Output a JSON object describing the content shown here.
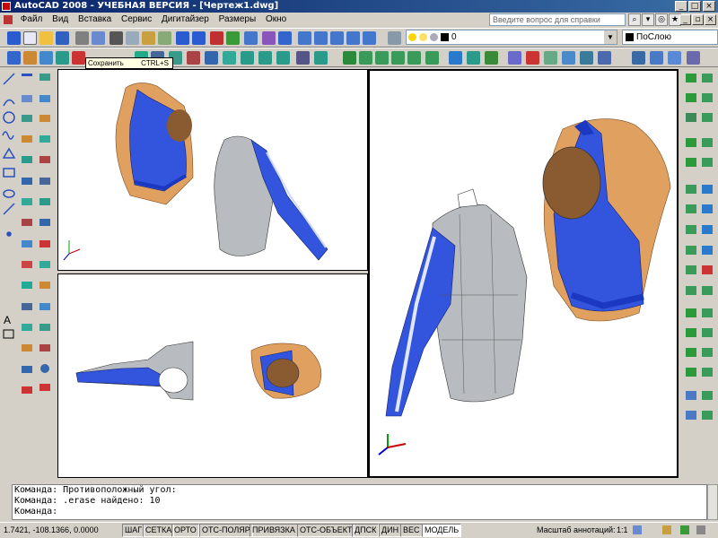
{
  "title": "AutoCAD 2008 - УЧЕБНАЯ ВЕРСИЯ - [Чертеж1.dwg]",
  "menu": [
    "Файл",
    "Вид",
    "Вставка",
    "Сервис",
    "Дигитайзер",
    "Размеры",
    "Окно"
  ],
  "help_placeholder": "Введите вопрос для справки",
  "layer_value": "0",
  "color_value": "ПоСлою",
  "tooltip": {
    "label": "Сохранить",
    "shortcut": "CTRL+S"
  },
  "command_lines": [
    "Команда: Противоположный угол:",
    "Команда:  .erase найдено: 10",
    "Команда:"
  ],
  "status": {
    "coords": "1.7421, -108.1366, 0.0000",
    "buttons": [
      "ШАГ",
      "СЕТКА",
      "ОРТО",
      "ОТС-ПОЛЯР",
      "ПРИВЯЗКА",
      "ОТС-ОБЪЕКТ",
      "ДПСК",
      "ДИН",
      "ВЕС",
      "МОДЕЛЬ"
    ],
    "scale_label": "Масштаб аннотаций:",
    "scale_value": "1:1"
  },
  "colors": {
    "title_start": "#0a246a",
    "title_end": "#3a6ea5",
    "garment_blue": "#3355dd",
    "body_tan": "#e0a060",
    "garment_gray": "#b8bcc0"
  }
}
